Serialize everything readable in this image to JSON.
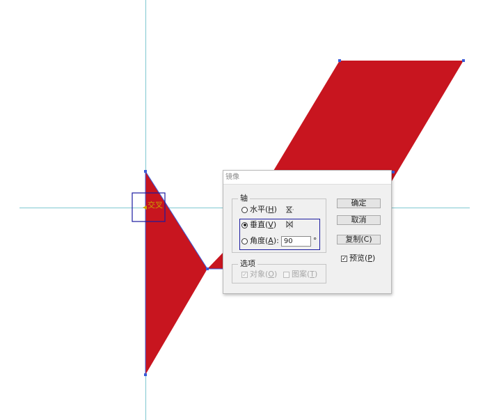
{
  "dialog": {
    "title": "镜像",
    "axis_group": {
      "legend": "轴",
      "horizontal": {
        "label": "水平(",
        "key": "H",
        "suffix": ")",
        "checked": false
      },
      "vertical": {
        "label": "垂直(",
        "key": "V",
        "suffix": ")",
        "checked": true
      },
      "angle": {
        "label": "角度(",
        "key": "A",
        "suffix": "):",
        "value": "90",
        "unit": "°",
        "checked": false
      }
    },
    "options_group": {
      "legend": "选项",
      "objects": {
        "label": "对象(",
        "key": "O",
        "suffix": ")",
        "checked": true,
        "disabled": true
      },
      "patterns": {
        "label": "图案(",
        "key": "T",
        "suffix": ")",
        "checked": false,
        "disabled": true
      }
    },
    "buttons": {
      "ok": "确定",
      "cancel": "取消",
      "copy": "复制(C)"
    },
    "preview": {
      "label": "预览(",
      "key": "P",
      "suffix": ")",
      "checked": true
    }
  },
  "canvas": {
    "cursor_label": "交叉",
    "colors": {
      "shape_fill": "#c8151f",
      "guide": "#7fc8d0",
      "selection": "#1a1aa0",
      "anchor": "#3a5bd9",
      "cursor": "#c8a200"
    }
  }
}
